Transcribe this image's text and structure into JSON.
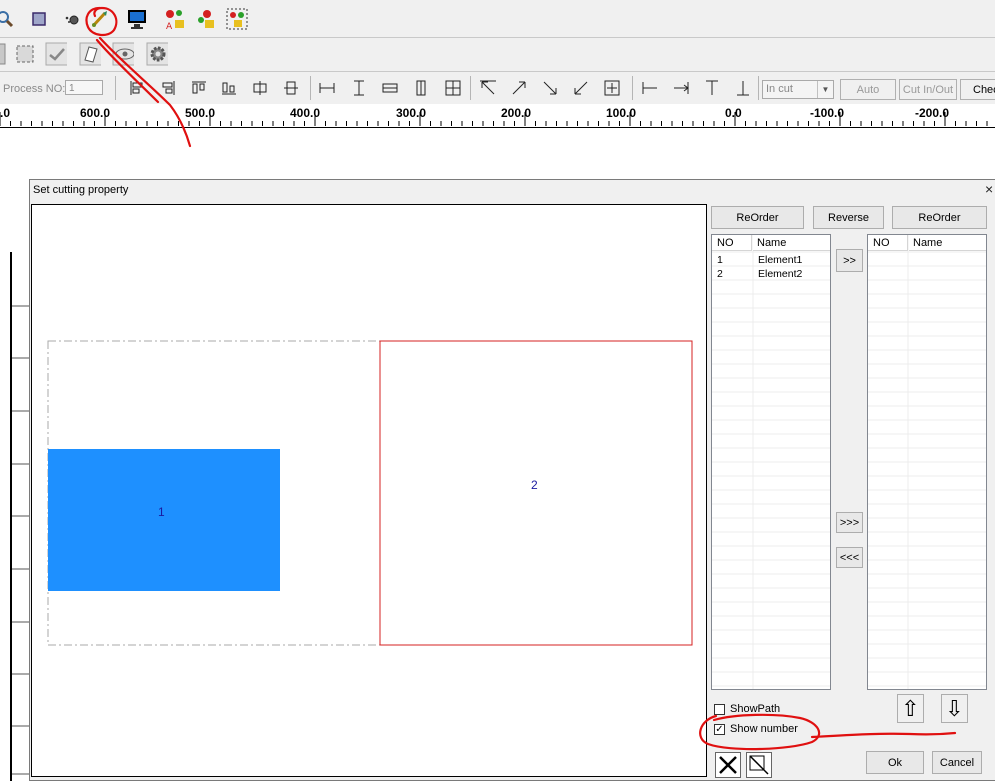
{
  "toolbar3": {
    "process_label": "Process NO:",
    "process_value": "1",
    "cut_combo_value": "In cut",
    "auto_button": "Auto",
    "cut_inout_button": "Cut In/Out",
    "check_button": "Chec"
  },
  "ruler": {
    "labels": [
      ".0",
      "600.0",
      "500.0",
      "400.0",
      "300.0",
      "200.0",
      "100.0",
      "0.0",
      "-100.0",
      "-200.0"
    ]
  },
  "dialog": {
    "title": "Set cutting property",
    "close_glyph": "×",
    "canvas": {
      "element1_number": "1",
      "element2_number": "2"
    },
    "reorder_left": "ReOrder",
    "reverse": "Reverse",
    "reorder_right": "ReOrder",
    "left_list": {
      "headers": [
        "NO",
        "Name"
      ],
      "rows": [
        {
          "no": "1",
          "name": "Element1"
        },
        {
          "no": "2",
          "name": "Element2"
        }
      ]
    },
    "right_list": {
      "headers": [
        "NO",
        "Name"
      ],
      "rows": []
    },
    "move_right": ">>",
    "move_all_right": ">>>",
    "move_all_left": "<<<",
    "show_path_label": "ShowPath",
    "show_path_checked": false,
    "show_number_label": "Show number",
    "show_number_checked": true,
    "check_glyph": "✓",
    "up_glyph": "⇧",
    "down_glyph": "⇩",
    "ok_button": "Ok",
    "cancel_button": "Cancel"
  },
  "colors": {
    "element1_fill": "#1e90ff",
    "element2_border": "#d62020",
    "annotation": "#e01010",
    "number_text": "#1a1aa0"
  }
}
